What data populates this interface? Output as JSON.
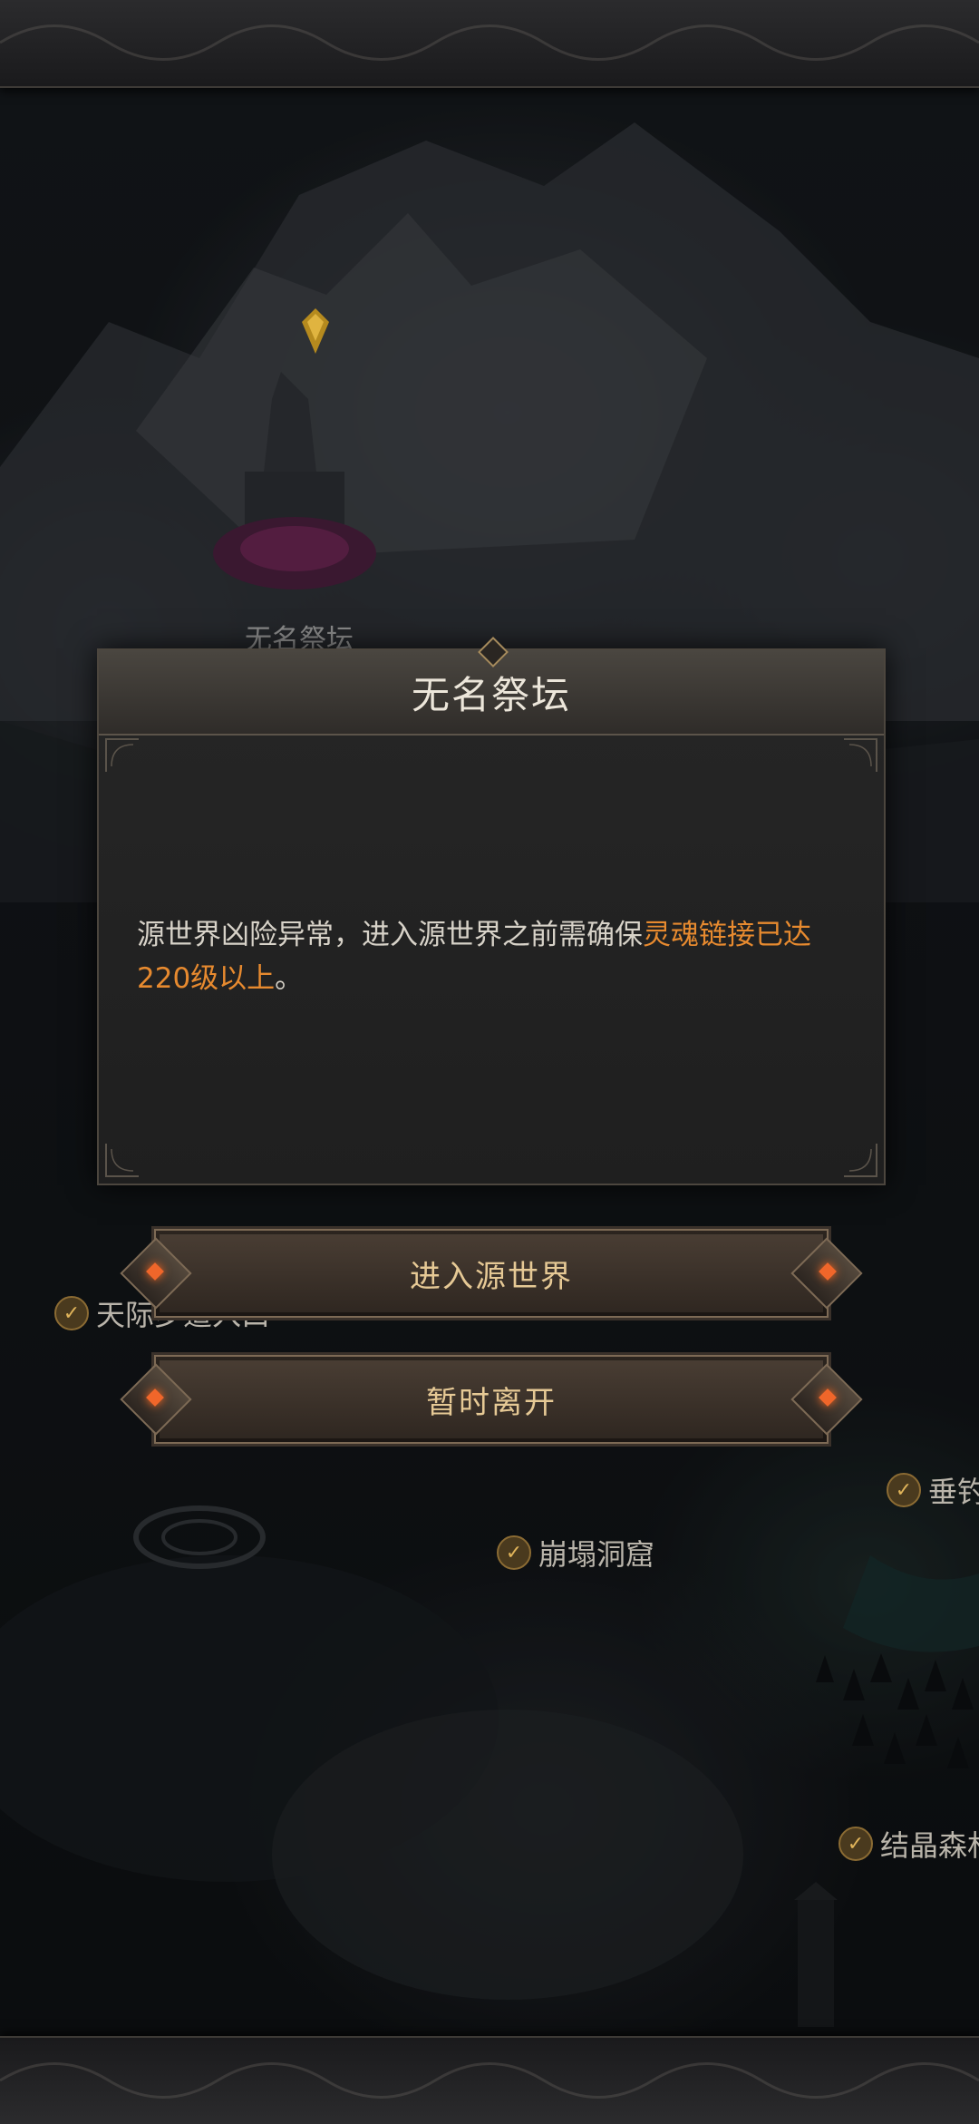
{
  "map": {
    "altar_label": "无名祭坛",
    "locations": [
      {
        "label": "天际步道入口"
      },
      {
        "label": "垂钓"
      },
      {
        "label": "崩塌洞窟"
      },
      {
        "label": "结晶森林"
      }
    ]
  },
  "dialog": {
    "title": "无名祭坛",
    "body_prefix": "源世界凶险异常，进入源世界之前需确保",
    "body_highlight": "灵魂链接已达220级以上",
    "body_suffix": "。"
  },
  "buttons": {
    "enter": "进入源世界",
    "leave": "暂时离开"
  },
  "colors": {
    "highlight": "#e78a2f",
    "button_text": "#e6c995",
    "gem": "#f0662a"
  }
}
